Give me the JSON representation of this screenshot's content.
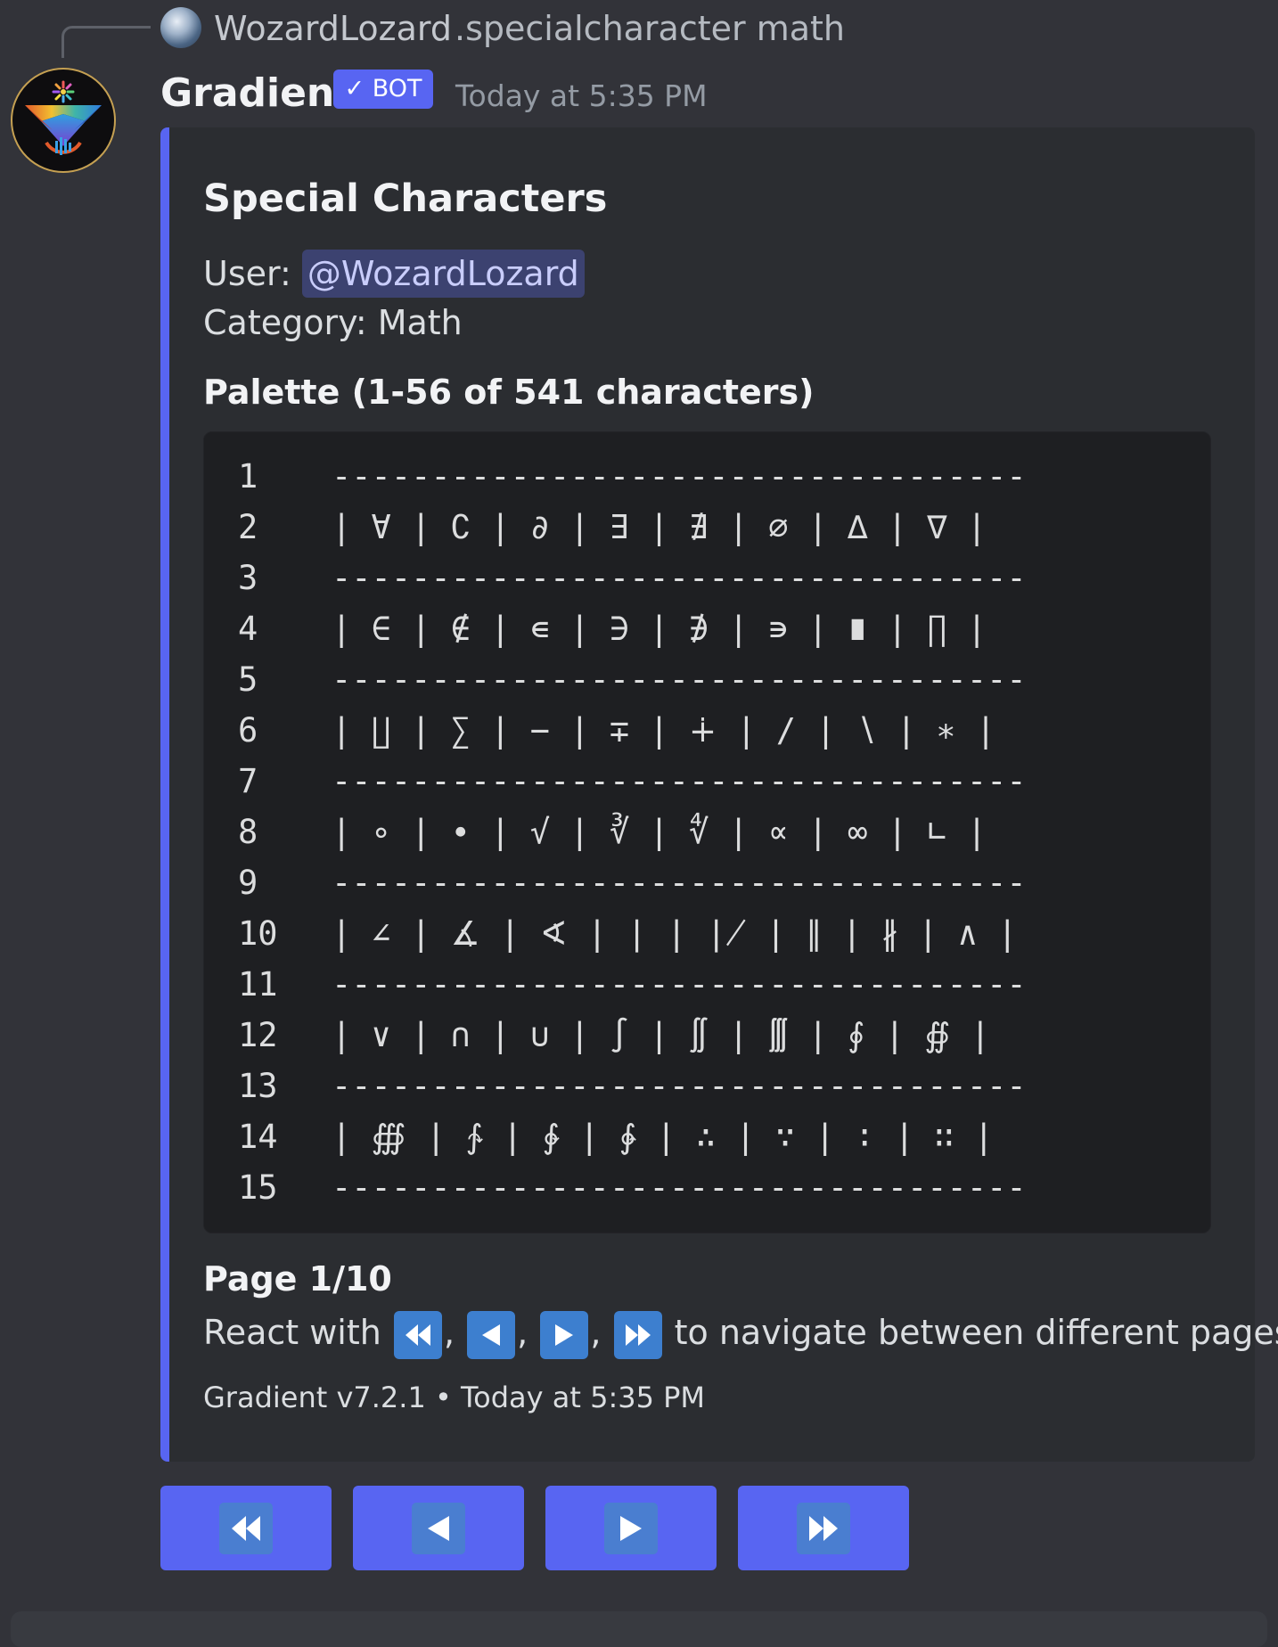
{
  "reply": {
    "username": "WozardLozard",
    "command": ".specialcharacter math"
  },
  "message": {
    "author": "Gradient",
    "bot_tag": "✓ BOT",
    "timestamp": "Today at 5:35 PM"
  },
  "embed": {
    "title": "Special Characters",
    "user_label": "User: ",
    "user_mention": "@WozardLozard",
    "category_label": "Category: ",
    "category_value": "Math",
    "palette_title": "Palette (1-56 of 541 characters)",
    "code_lines": [
      {
        "num": "1",
        "text": "-----------------------------------"
      },
      {
        "num": "2",
        "text": "| ∀ | ∁ | ∂ | ∃ | ∄ | ∅ | ∆ | ∇ |"
      },
      {
        "num": "3",
        "text": "-----------------------------------"
      },
      {
        "num": "4",
        "text": "| ∈ | ∉ | ∊ | ∋ | ∌ | ∍ | ∎ | ∏ |"
      },
      {
        "num": "5",
        "text": "-----------------------------------"
      },
      {
        "num": "6",
        "text": "| ∐ | ∑ | − | ∓ | ∔ | ∕ | ∖ | ∗ |"
      },
      {
        "num": "7",
        "text": "-----------------------------------"
      },
      {
        "num": "8",
        "text": "| ∘ | ∙ | √ | ∛ | ∜ | ∝ | ∞ | ∟ |"
      },
      {
        "num": "9",
        "text": "-----------------------------------"
      },
      {
        "num": "10",
        "text": "| ∠ | ∡ | ∢ | ∣ | ∤ | ∥ | ∦ | ∧ |"
      },
      {
        "num": "11",
        "text": "-----------------------------------"
      },
      {
        "num": "12",
        "text": "| ∨ | ∩ | ∪ | ∫ | ∬ | ∭ | ∮ | ∯ |"
      },
      {
        "num": "13",
        "text": "-----------------------------------"
      },
      {
        "num": "14",
        "text": "| ∰ | ∱ | ∲ | ∳ | ∴ | ∵ | ∶ | ∷ |"
      },
      {
        "num": "15",
        "text": "-----------------------------------"
      }
    ],
    "page_label": "Page 1/10",
    "react_prefix": "React with",
    "react_sep": ",",
    "react_suffix": "to navigate between different pages.",
    "footer": "Gradient v7.2.1 • Today at 5:35 PM"
  },
  "buttons": [
    {
      "icon": "fast-backward-icon"
    },
    {
      "icon": "previous-icon"
    },
    {
      "icon": "next-icon"
    },
    {
      "icon": "fast-forward-icon"
    }
  ],
  "colors": {
    "background": "#323339",
    "embed_background": "#2b2d31",
    "embed_accent": "#5865f2",
    "code_background": "#1e1f22",
    "button_primary": "#5865f2",
    "emoji_blue": "#3d7fcf",
    "mention_bg": "#3c4270"
  }
}
